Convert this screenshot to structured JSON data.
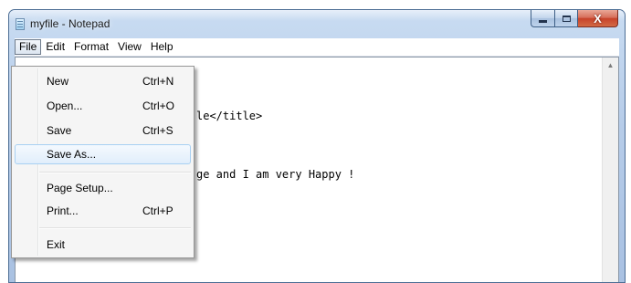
{
  "window": {
    "title": "myfile - Notepad",
    "controls": {
      "minimize_icon": "minimize-icon",
      "maximize_icon": "maximize-icon",
      "close_symbol": "X"
    }
  },
  "menubar": {
    "items": [
      "File",
      "Edit",
      "Format",
      "View",
      "Help"
    ],
    "active": "File"
  },
  "editor": {
    "visible_lines": [
      "le</title>",
      "ge and I am very Happy !"
    ]
  },
  "file_menu": {
    "items": [
      {
        "label": "New",
        "shortcut": "Ctrl+N"
      },
      {
        "label": "Open...",
        "shortcut": "Ctrl+O"
      },
      {
        "label": "Save",
        "shortcut": "Ctrl+S"
      },
      {
        "label": "Save As...",
        "shortcut": ""
      },
      {
        "label": "Page Setup...",
        "shortcut": ""
      },
      {
        "label": "Print...",
        "shortcut": "Ctrl+P"
      },
      {
        "label": "Exit",
        "shortcut": ""
      }
    ],
    "highlighted": "Save As..."
  },
  "scrollbar": {
    "up_arrow": "▲"
  }
}
